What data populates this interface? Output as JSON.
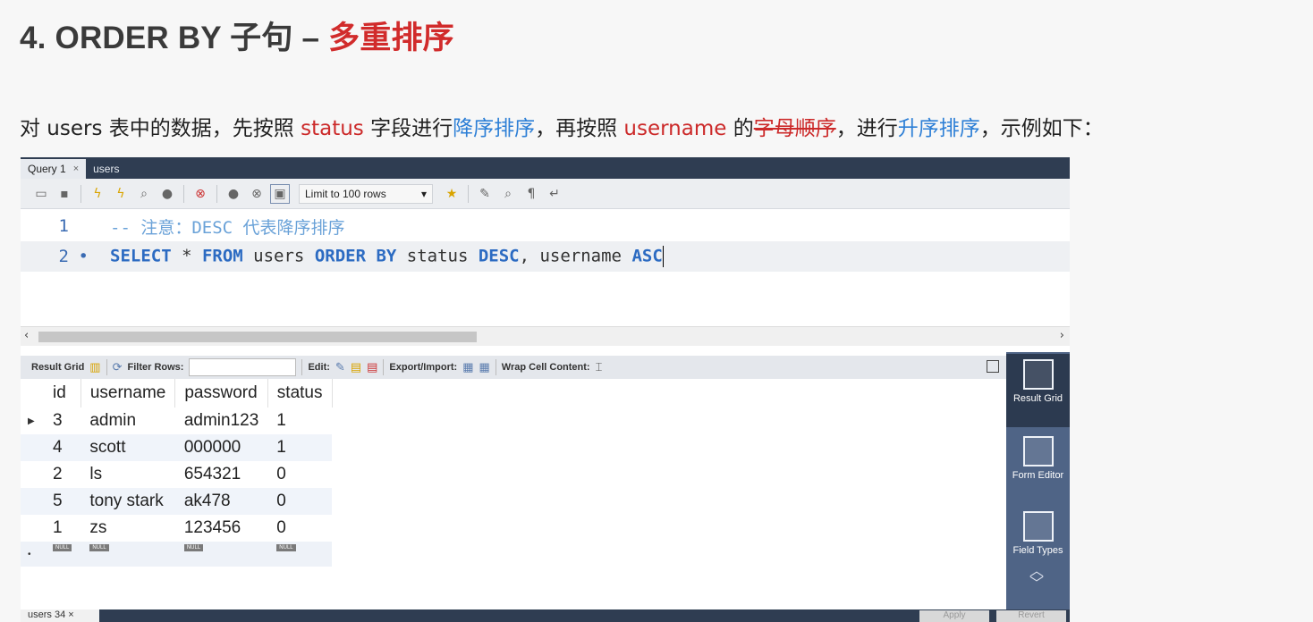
{
  "title": {
    "prefix": "4. ORDER BY 子句 – ",
    "highlight": "多重排序"
  },
  "description": {
    "p1": "对 users 表中的数据，先按照 ",
    "field1": "status",
    "p2": " 字段进行",
    "order1": "降序排序",
    "p3": "，再按照 ",
    "field2": "username",
    "p4": " 的",
    "alpha": "字母顺序",
    "p5": "，进行",
    "order2": "升序排序",
    "p6": "，示例如下："
  },
  "tabs": [
    {
      "label": "Query 1",
      "close": "×"
    },
    {
      "label": "users"
    }
  ],
  "toolbar": {
    "limit_label": "Limit to 100 rows",
    "limit_arrow": "▾"
  },
  "editor": {
    "line1": {
      "num": "1",
      "comment": "-- 注意：DESC 代表降序排序"
    },
    "line2": {
      "num": "2",
      "dot": "•",
      "kw1": "SELECT",
      "t1": " * ",
      "kw2": "FROM",
      "t2": " users ",
      "kw3": "ORDER BY",
      "t3": " status ",
      "kw4": "DESC",
      "t4": ", username ",
      "kw5": "ASC"
    }
  },
  "scroll": {
    "left": "‹",
    "right": "›"
  },
  "result_bar": {
    "result_grid": "Result Grid",
    "filter_rows": "Filter Rows:",
    "edit": "Edit:",
    "export_import": "Export/Import:",
    "wrap": "Wrap Cell Content:"
  },
  "grid": {
    "columns": [
      "id",
      "username",
      "password",
      "status"
    ],
    "rows": [
      [
        "3",
        "admin",
        "admin123",
        "1"
      ],
      [
        "4",
        "scott",
        "000000",
        "1"
      ],
      [
        "2",
        "ls",
        "654321",
        "0"
      ],
      [
        "5",
        "tony stark",
        "ak478",
        "0"
      ],
      [
        "1",
        "zs",
        "123456",
        "0"
      ]
    ],
    "current_marker": "▶",
    "new_marker": "•",
    "null_label": "NULL"
  },
  "side_panel": {
    "result_grid": "Result Grid",
    "form_editor": "Form Editor",
    "field_types": "Field Types"
  },
  "bottom": {
    "tab": "users 34",
    "close": "×",
    "apply": "Apply",
    "revert": "Revert"
  },
  "colors": {
    "accent_red": "#d12b2b",
    "accent_blue": "#2d7fd6",
    "sidebar": "#4f6486",
    "tabbar": "#2f3d52"
  }
}
